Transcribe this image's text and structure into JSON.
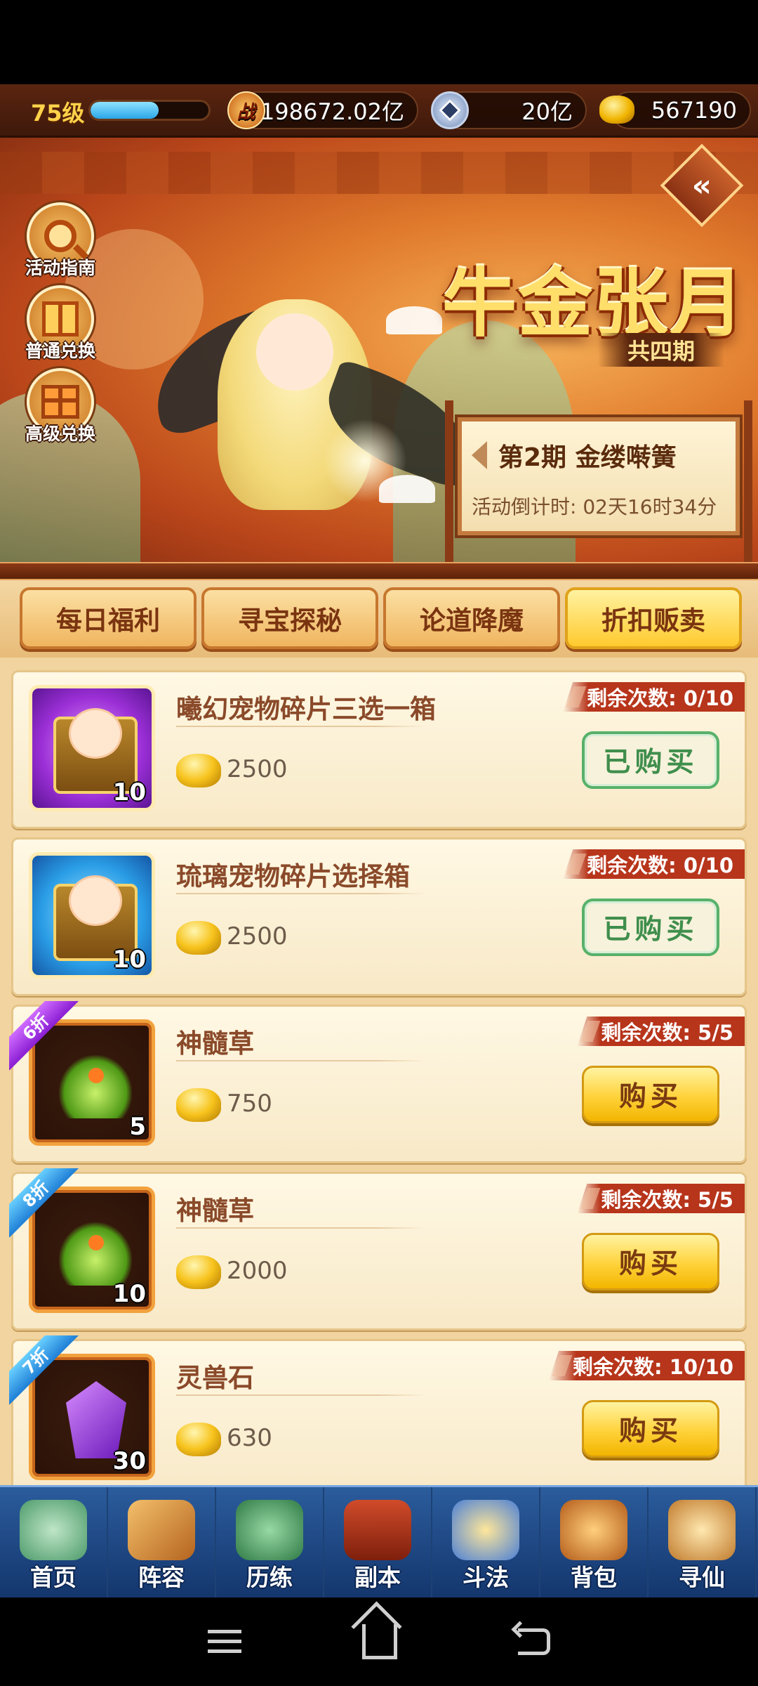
{
  "topbar": {
    "level": "75级",
    "exp_progress": 0.58,
    "power_icon_text": "战",
    "power": "198672.02亿",
    "silver": "20亿",
    "gold": "567190"
  },
  "banner": {
    "title": "牛金张月",
    "periods": "共四期",
    "period_label": "第2期  金缕啭簧",
    "countdown": "活动倒计时: 02天16时34分",
    "side_buttons": [
      {
        "label": "活动指南",
        "icon": "magnifier-icon"
      },
      {
        "label": "普通兑换",
        "icon": "box-icon"
      },
      {
        "label": "高级兑换",
        "icon": "gift-icon"
      }
    ],
    "back_glyph": "«"
  },
  "tabs": [
    {
      "label": "每日福利",
      "active": false
    },
    {
      "label": "寻宝探秘",
      "active": false
    },
    {
      "label": "论道降魔",
      "active": false
    },
    {
      "label": "折扣贩卖",
      "active": true
    }
  ],
  "items": [
    {
      "name": "曦幻宠物碎片三选一箱",
      "price": "2500",
      "qty": "10",
      "remaining": "剩余次数: 0/10",
      "button": "已购买",
      "state": "bought",
      "discount": "",
      "frame": "purple",
      "icon": "chest"
    },
    {
      "name": "琉璃宠物碎片选择箱",
      "price": "2500",
      "qty": "10",
      "remaining": "剩余次数: 0/10",
      "button": "已购买",
      "state": "bought",
      "discount": "",
      "frame": "blue",
      "icon": "chest"
    },
    {
      "name": "神髓草",
      "price": "750",
      "qty": "5",
      "remaining": "剩余次数: 5/5",
      "button": "购买",
      "state": "buy",
      "discount": "6折",
      "discount_color": "purple",
      "frame": "orange",
      "icon": "plant"
    },
    {
      "name": "神髓草",
      "price": "2000",
      "qty": "10",
      "remaining": "剩余次数: 5/5",
      "button": "购买",
      "state": "buy",
      "discount": "8折",
      "discount_color": "blue",
      "frame": "orange",
      "icon": "plant"
    },
    {
      "name": "灵兽石",
      "price": "630",
      "qty": "30",
      "remaining": "剩余次数: 10/10",
      "button": "购买",
      "state": "buy",
      "discount": "7折",
      "discount_color": "blue",
      "frame": "orange",
      "icon": "gem"
    }
  ],
  "bottom_nav": [
    {
      "label": "首页",
      "icon": "home-island-icon"
    },
    {
      "label": "阵容",
      "icon": "cards-icon"
    },
    {
      "label": "历练",
      "icon": "training-icon"
    },
    {
      "label": "副本",
      "icon": "gate-icon"
    },
    {
      "label": "斗法",
      "icon": "sword-icon"
    },
    {
      "label": "背包",
      "icon": "bag-icon"
    },
    {
      "label": "寻仙",
      "icon": "scroll-icon"
    }
  ],
  "colors": {
    "accent_gold": "#ffd23a",
    "bought_green": "#58b16a",
    "remaining_red": "#b7351b",
    "nav_blue": "#2b5c9c"
  }
}
